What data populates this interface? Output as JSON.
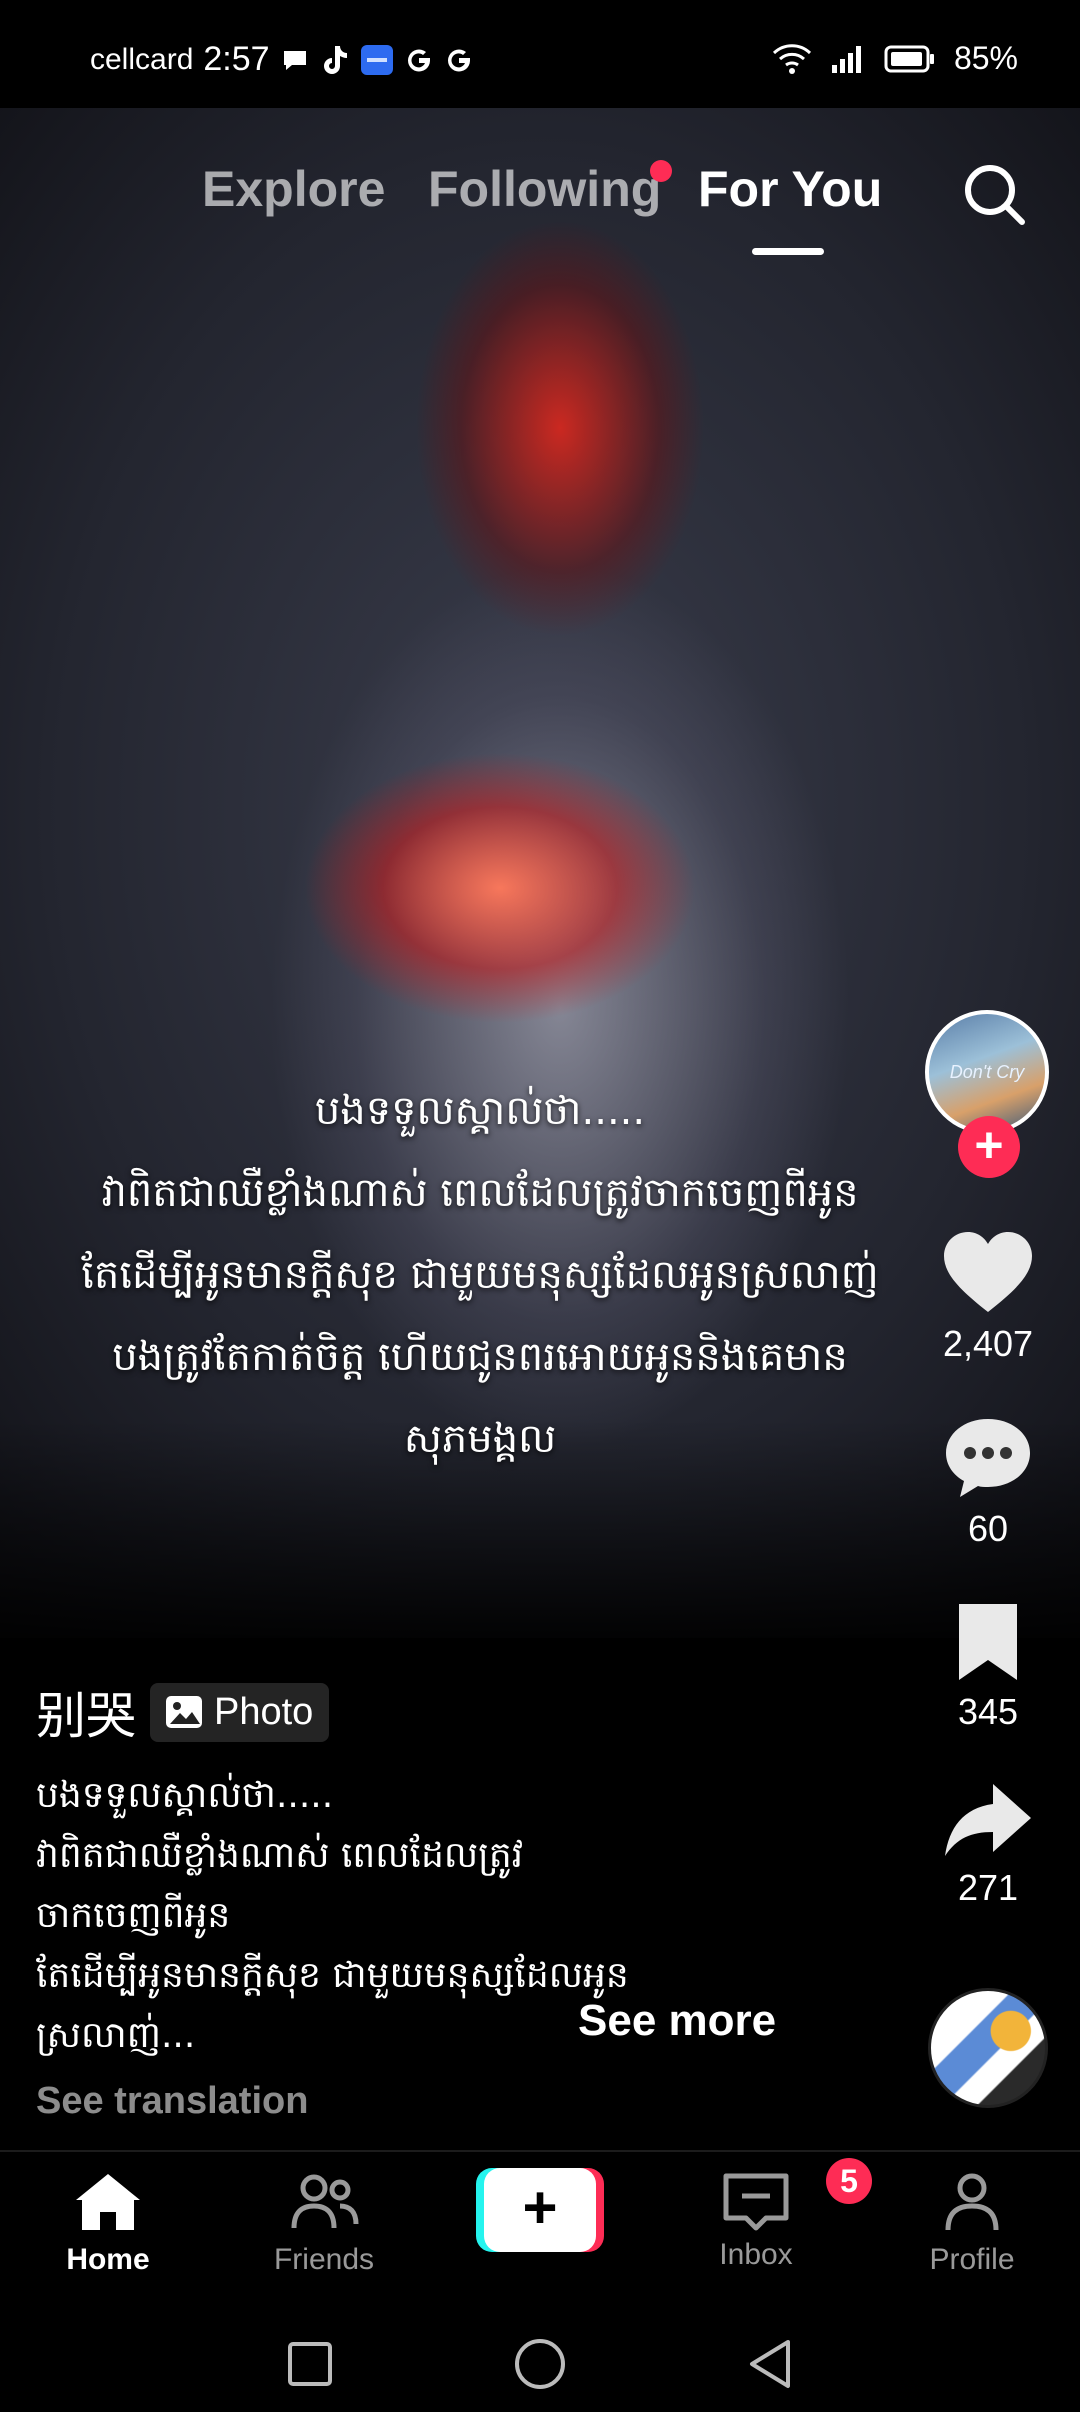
{
  "status_bar": {
    "carrier": "cellcard",
    "time": "2:57",
    "notification_icons": [
      "chat-bubble-icon",
      "tiktok-icon",
      "app-icon",
      "google-icon",
      "google-icon"
    ],
    "battery_percent": "85%"
  },
  "top_tabs": {
    "explore": "Explore",
    "following": "Following",
    "for_you": "For You",
    "active": "For You"
  },
  "overlay_caption": {
    "lines": [
      "បងទទួលស្គាល់ថា.....",
      "វាពិតជាឈឺខ្លាំងណាស់ ពេលដែលត្រូវចាកចេញពីអូន",
      "តែដើម្បីអូនមានក្តីសុខ ជាមួយមនុស្សដែលអូនស្រលាញ់",
      "បងត្រូវតែកាត់ចិត្ត ហើយជូនពរអោយអូននិងគេមាន",
      "សុភមង្គល"
    ]
  },
  "avatar": {
    "text": "Don't Cry"
  },
  "actions": {
    "likes": "2,407",
    "comments": "60",
    "saves": "345",
    "shares": "271"
  },
  "post": {
    "author": "别哭",
    "badge": "Photo",
    "description_lines": [
      "បងទទួលស្គាល់ថា.....",
      "វាពិតជាឈឺខ្លាំងណាស់ ពេលដែលត្រូវ",
      "ចាកចេញពីអូន",
      "តែដើម្បីអូនមានក្តីសុខ ជាមួយមនុស្សដែលអូន",
      "ស្រលាញ់..."
    ],
    "see_more": "See more",
    "see_translation": "See translation"
  },
  "bottom_nav": {
    "home": "Home",
    "friends": "Friends",
    "inbox": "Inbox",
    "inbox_badge": "5",
    "profile": "Profile",
    "create": "+"
  },
  "colors": {
    "accent": "#fe2c55",
    "cyan": "#25f4ee",
    "background": "#000000"
  }
}
